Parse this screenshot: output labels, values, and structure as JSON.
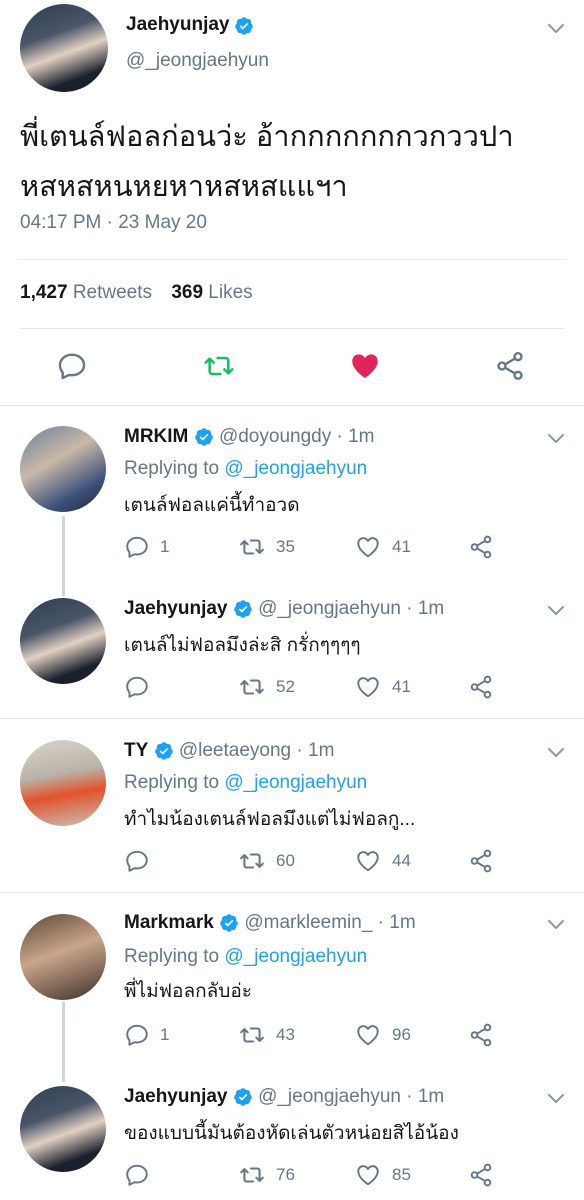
{
  "main_tweet": {
    "author_name": "Jaehyunjay",
    "author_handle": "@_jeongjaehyun",
    "text_line1": "พี่เตนล์ฟอลก่อนว่ะ อ้ากกกกกกกวกววปา",
    "text_line2": "หสหสหนหยหาหสหสแแฯา",
    "timestamp": "04:17 PM · 23 May 20",
    "retweets_count": "1,427",
    "retweets_label": "Retweets",
    "likes_count": "369",
    "likes_label": "Likes",
    "liked": true
  },
  "replies": [
    {
      "author_name": "MRKIM",
      "author_handle": "@doyoungdy",
      "time": "· 1m",
      "replying_label": "Replying to",
      "replying_to": "@_jeongjaehyun",
      "text": "เตนล์ฟอลแค่นี้ทำอวด",
      "reply_count": "1",
      "retweet_count": "35",
      "like_count": "41"
    },
    {
      "author_name": "Jaehyunjay",
      "author_handle": "@_jeongjaehyun",
      "time": "· 1m",
      "text": "เตนล์ไม่ฟอลมึงล่ะสิ กรั่กๆๆๆๆ",
      "reply_count": "",
      "retweet_count": "52",
      "like_count": "41"
    },
    {
      "author_name": "TY",
      "author_handle": "@leetaeyong",
      "time": "· 1m",
      "replying_label": "Replying to",
      "replying_to": "@_jeongjaehyun",
      "text": "ทำไมน้องเตนล์ฟอลมึงแต่ไม่ฟอลกู...",
      "reply_count": "",
      "retweet_count": "60",
      "like_count": "44"
    },
    {
      "author_name": "Markmark",
      "author_handle": "@markleemin_",
      "time": "· 1m",
      "replying_label": "Replying to",
      "replying_to": "@_jeongjaehyun",
      "text": "พี่ไม่ฟอลกลับอ่ะ",
      "reply_count": "1",
      "retweet_count": "43",
      "like_count": "96"
    },
    {
      "author_name": "Jaehyunjay",
      "author_handle": "@_jeongjaehyun",
      "time": "· 1m",
      "text": "ของแบบนี้มันต้องหัดเล่นตัวหน่อยสิไอ้น้อง",
      "reply_count": "",
      "retweet_count": "76",
      "like_count": "85"
    }
  ],
  "icons": {
    "reply": "reply-icon",
    "retweet": "retweet-icon",
    "like": "heart-icon",
    "share": "share-icon",
    "verified": "verified-badge-icon",
    "menu": "chevron-down-icon"
  },
  "colors": {
    "verified_blue": "#1da1f2",
    "retweet_green": "#17bf63",
    "like_red": "#e0245e",
    "muted": "#657786"
  }
}
